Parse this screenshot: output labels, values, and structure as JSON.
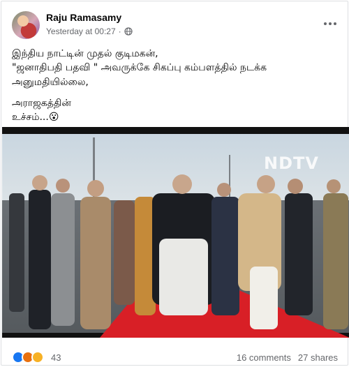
{
  "post": {
    "author": "Raju Ramasamy",
    "timestamp": "Yesterday at 00:27",
    "separator": "·",
    "audience_icon": "globe-icon",
    "more_icon": "more-options-icon",
    "text_lines": [
      "இந்திய நாட்டின் முதல் குடிமகன்,",
      "\"ஜனாதிபதி பதவி \" அவருக்கே சிகப்பு கம்பளத்தில் நடக்க",
      "அனுமதியில்லை,",
      "அராஜகத்தின்",
      "உச்சம்...😮"
    ]
  },
  "media": {
    "watermark": "NDTV"
  },
  "engagement": {
    "reaction_icons": [
      "like-icon",
      "angry-icon",
      "haha-icon"
    ],
    "reaction_count": "43",
    "comments": "16 comments",
    "shares": "27 shares"
  },
  "colors": {
    "text_primary": "#050505",
    "text_secondary": "#65676b",
    "carpet": "#d81f26",
    "like": "#1877f2"
  }
}
